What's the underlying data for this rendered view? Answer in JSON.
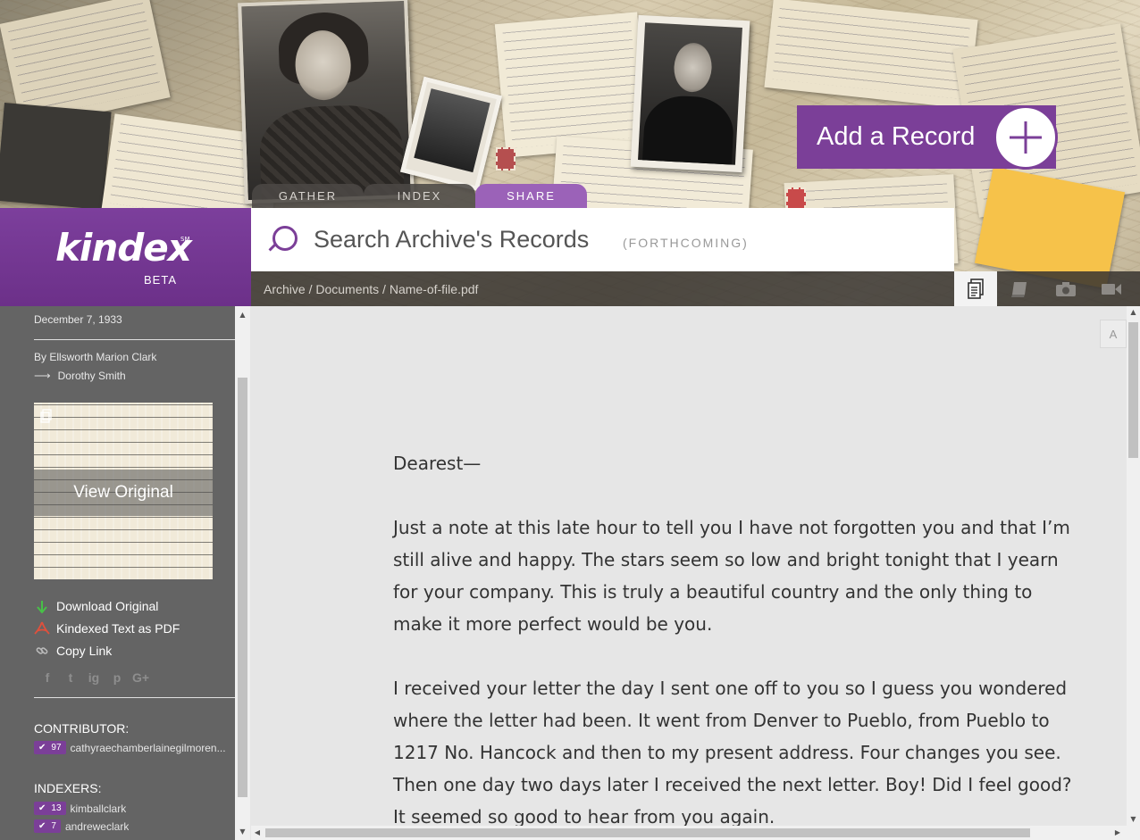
{
  "header": {
    "add_record_label": "Add a Record",
    "tabs": [
      {
        "label": "GATHER",
        "active": false
      },
      {
        "label": "INDEX",
        "active": false
      },
      {
        "label": "SHARE",
        "active": true
      }
    ],
    "accent_color": "#7b3f98"
  },
  "logo": {
    "name": "kindex",
    "trademark": "SM",
    "beta": "BETA"
  },
  "search": {
    "placeholder": "Search Archive's Records",
    "note": "(FORTHCOMING)"
  },
  "breadcrumb": {
    "text": "Archive / Documents / Name-of-file.pdf"
  },
  "media_types": [
    {
      "icon": "document-icon",
      "active": true
    },
    {
      "icon": "book-icon",
      "active": false
    },
    {
      "icon": "camera-icon",
      "active": false
    },
    {
      "icon": "video-icon",
      "active": false
    }
  ],
  "sidebar": {
    "date": "December 7, 1933",
    "by": "By Ellsworth Marion Clark",
    "to": "Dorothy Smith",
    "view_original": "View Original",
    "actions": [
      {
        "label": "Download Original",
        "icon": "download-icon"
      },
      {
        "label": "Kindexed Text as PDF",
        "icon": "pdf-icon"
      },
      {
        "label": "Copy Link",
        "icon": "link-icon"
      }
    ],
    "social": [
      "f",
      "t",
      "ig",
      "p",
      "G+"
    ],
    "contributor_title": "CONTRIBUTOR:",
    "contributors": [
      {
        "count": "97",
        "name": "cathyraechamberlainegilmoren..."
      }
    ],
    "indexers_title": "INDEXERS:",
    "indexers": [
      {
        "count": "13",
        "name": "kimballclark"
      },
      {
        "count": "7",
        "name": "andreweclark"
      }
    ]
  },
  "main": {
    "font_button": "A",
    "letter": {
      "salutation": "Dearest—",
      "paragraphs": [
        "Just a note at this late hour to tell you I have not forgotten you and that I’m still alive and happy. The stars seem so low and bright tonight that I yearn for your company. This is truly a beautiful country and the only thing to make it more perfect would be you.",
        "I received your letter the day I sent one off to you so I guess you wondered where the letter had been. It went from Denver to Pueblo, from Pueblo to 1217 No. Hancock and then to my present address. Four changes you see. Then one day two days later I received the next letter. Boy! Did I feel good? It seemed so good to hear from you again."
      ]
    }
  }
}
